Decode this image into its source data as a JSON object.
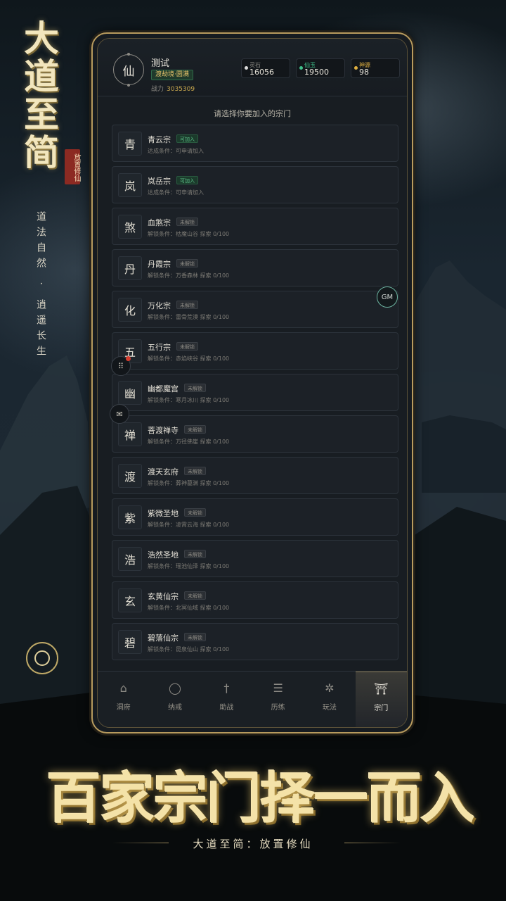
{
  "game_title_chars": [
    "大",
    "道",
    "至",
    "简"
  ],
  "seal_text": "放置修仙",
  "side_poem": "道法自然 · 逍遥长生",
  "player": {
    "avatar_char": "仙",
    "name": "测试",
    "realm": "渡劫境·圆满",
    "power_label": "战力",
    "power_value": "3035309"
  },
  "resources": [
    {
      "label": "灵石",
      "value": "16056",
      "color": "#dcdcdc"
    },
    {
      "label": "仙玉",
      "value": "19500",
      "color": "#3fc08a"
    },
    {
      "label": "神源",
      "value": "98",
      "color": "#e0b040"
    }
  ],
  "prompt": "请选择你要加入的宗门",
  "sects": [
    {
      "glyph": "青",
      "name": "青云宗",
      "status": "可加入",
      "open": true,
      "condition": "达成条件：可申请加入"
    },
    {
      "glyph": "岚",
      "name": "岚岳宗",
      "status": "可加入",
      "open": true,
      "condition": "达成条件：可申请加入"
    },
    {
      "glyph": "煞",
      "name": "血煞宗",
      "status": "未解锁",
      "open": false,
      "condition": "解锁条件：枯魔山谷 探索 0/100"
    },
    {
      "glyph": "丹",
      "name": "丹霞宗",
      "status": "未解锁",
      "open": false,
      "condition": "解锁条件：万香森林 探索 0/100"
    },
    {
      "glyph": "化",
      "name": "万化宗",
      "status": "未解锁",
      "open": false,
      "condition": "解锁条件：雷骨荒漠 探索 0/100"
    },
    {
      "glyph": "五",
      "name": "五行宗",
      "status": "未解锁",
      "open": false,
      "condition": "解锁条件：赤焰峡谷 探索 0/100"
    },
    {
      "glyph": "幽",
      "name": "幽都魔宫",
      "status": "未解锁",
      "open": false,
      "condition": "解锁条件：寒月冰川 探索 0/100"
    },
    {
      "glyph": "禅",
      "name": "菩渡禅寺",
      "status": "未解锁",
      "open": false,
      "condition": "解锁条件：万径佛崖 探索 0/100"
    },
    {
      "glyph": "渡",
      "name": "渡天玄府",
      "status": "未解锁",
      "open": false,
      "condition": "解锁条件：葬神墓渊 探索 0/100"
    },
    {
      "glyph": "紫",
      "name": "紫微圣地",
      "status": "未解锁",
      "open": false,
      "condition": "解锁条件：凌霄云海 探索 0/100"
    },
    {
      "glyph": "浩",
      "name": "浩然圣地",
      "status": "未解锁",
      "open": false,
      "condition": "解锁条件：瑶池仙泽 探索 0/100"
    },
    {
      "glyph": "玄",
      "name": "玄黄仙宗",
      "status": "未解锁",
      "open": false,
      "condition": "解锁条件：北冥仙域 探索 0/100"
    },
    {
      "glyph": "碧",
      "name": "碧落仙宗",
      "status": "未解锁",
      "open": false,
      "condition": "解锁条件：昆泉仙山 探索 0/100"
    }
  ],
  "gm_label": "GM",
  "nav": [
    {
      "label": "洞府",
      "icon": "house-icon",
      "glyph": "⌂"
    },
    {
      "label": "纳戒",
      "icon": "ring-icon",
      "glyph": "◯"
    },
    {
      "label": "助战",
      "icon": "sword-icon",
      "glyph": "†"
    },
    {
      "label": "历练",
      "icon": "scroll-icon",
      "glyph": "☰"
    },
    {
      "label": "玩法",
      "icon": "compass-icon",
      "glyph": "✲"
    },
    {
      "label": "宗门",
      "icon": "pagoda-icon",
      "glyph": "⛩"
    }
  ],
  "nav_active_index": 5,
  "banner": "百家宗门择一而入",
  "subtitle": "大道至简：放置修仙"
}
